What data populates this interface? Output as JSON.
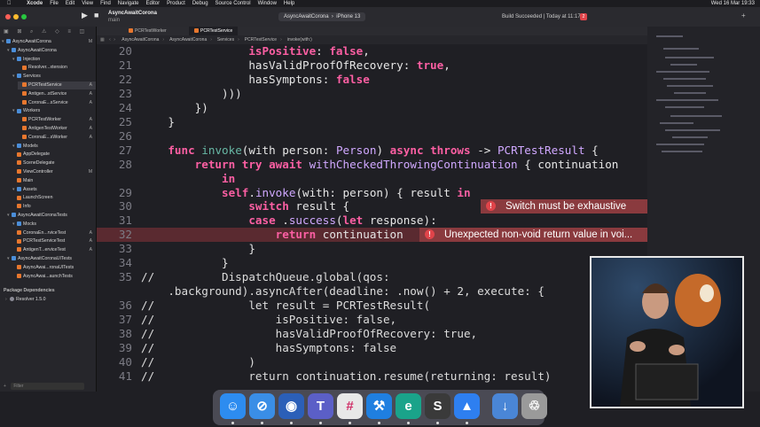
{
  "menubar": {
    "app": "Xcode",
    "items": [
      "File",
      "Edit",
      "View",
      "Find",
      "Navigate",
      "Editor",
      "Product",
      "Debug",
      "Source Control",
      "Window",
      "Help"
    ],
    "clock": "Wed 16 Mar 19:33"
  },
  "toolbar": {
    "project": "AsyncAwaitCorona",
    "branch": "main",
    "scheme": "AsyncAwaitCorona",
    "device": "iPhone 13",
    "status": "Build Succeeded | Today at 11:17",
    "error_count": "2"
  },
  "tabs": [
    "PCRTestWorker",
    "PCRTestService"
  ],
  "jumpbar": [
    "AsyncAwaitCorona",
    "AsyncAwaitCorona",
    "Services",
    "PCRTestService",
    "invoke(with:)"
  ],
  "navigator": {
    "items": [
      {
        "label": "AsyncAwaitCorona",
        "indent": 0,
        "kind": "project",
        "badge": "M"
      },
      {
        "label": "AsyncAwaitCorona",
        "indent": 1,
        "kind": "folder",
        "badge": ""
      },
      {
        "label": "Injection",
        "indent": 2,
        "kind": "folder",
        "badge": ""
      },
      {
        "label": "Resolver...xtension",
        "indent": 3,
        "kind": "swift",
        "badge": ""
      },
      {
        "label": "Services",
        "indent": 2,
        "kind": "folder",
        "badge": ""
      },
      {
        "label": "PCRTestService",
        "indent": 3,
        "kind": "swift",
        "badge": "A"
      },
      {
        "label": "Antigen...stService",
        "indent": 3,
        "kind": "swift",
        "badge": "A"
      },
      {
        "label": "CoronaE...sService",
        "indent": 3,
        "kind": "swift",
        "badge": "A"
      },
      {
        "label": "Workers",
        "indent": 2,
        "kind": "folder",
        "badge": ""
      },
      {
        "label": "PCRTestWorker",
        "indent": 3,
        "kind": "swift",
        "badge": "A"
      },
      {
        "label": "AntigenTestWorker",
        "indent": 3,
        "kind": "swift",
        "badge": "A"
      },
      {
        "label": "CoronaE...sWorker",
        "indent": 3,
        "kind": "swift",
        "badge": "A"
      },
      {
        "label": "Models",
        "indent": 2,
        "kind": "folder",
        "badge": ""
      },
      {
        "label": "AppDelegate",
        "indent": 2,
        "kind": "swift",
        "badge": ""
      },
      {
        "label": "SceneDelegate",
        "indent": 2,
        "kind": "swift",
        "badge": ""
      },
      {
        "label": "ViewController",
        "indent": 2,
        "kind": "swift",
        "badge": "M"
      },
      {
        "label": "Main",
        "indent": 2,
        "kind": "swift",
        "badge": ""
      },
      {
        "label": "Assets",
        "indent": 2,
        "kind": "folder",
        "badge": ""
      },
      {
        "label": "LaunchScreen",
        "indent": 2,
        "kind": "swift",
        "badge": ""
      },
      {
        "label": "Info",
        "indent": 2,
        "kind": "swift",
        "badge": ""
      },
      {
        "label": "AsyncAwaitCoronaTests",
        "indent": 1,
        "kind": "folder",
        "badge": ""
      },
      {
        "label": "Mocks",
        "indent": 2,
        "kind": "folder",
        "badge": ""
      },
      {
        "label": "CoronaEn...rviceTest",
        "indent": 2,
        "kind": "swift",
        "badge": "A"
      },
      {
        "label": "PCRTestServiceTest",
        "indent": 2,
        "kind": "swift",
        "badge": "A"
      },
      {
        "label": "AntigenT...erviceTest",
        "indent": 2,
        "kind": "swift",
        "badge": "A"
      },
      {
        "label": "AsyncAwaitCoronaUITests",
        "indent": 1,
        "kind": "folder",
        "badge": ""
      },
      {
        "label": "AsyncAwai...ronaUITests",
        "indent": 2,
        "kind": "swift",
        "badge": ""
      },
      {
        "label": "AsyncAwai...aunchTests",
        "indent": 2,
        "kind": "swift",
        "badge": ""
      }
    ],
    "package_header": "Package Dependencies",
    "package": "Resolver 1.5.0",
    "filter_placeholder": "Filter"
  },
  "code": [
    {
      "n": "20",
      "html": "                <span class='kw'>isPositive</span>: <span class='kw'>false</span>,"
    },
    {
      "n": "21",
      "html": "                hasValidProofOfRecovery: <span class='kw'>true</span>,"
    },
    {
      "n": "22",
      "html": "                hasSymptons: <span class='kw'>false</span>"
    },
    {
      "n": "23",
      "html": "            )))"
    },
    {
      "n": "24",
      "html": "        })"
    },
    {
      "n": "25",
      "html": "    }"
    },
    {
      "n": "26",
      "html": ""
    },
    {
      "n": "27",
      "html": "    <span class='kw'>func</span> <span class='fn'>invoke</span>(with person: <span class='ty'>Person</span>) <span class='kw'>async throws</span> -&gt; <span class='ty'>PCRTestResult</span> {"
    },
    {
      "n": "28",
      "html": "        <span class='kw'>return try await</span> <span class='ty'>withCheckedThrowingContinuation</span> { continuation"
    },
    {
      "n": "",
      "html": "            <span class='kw'>in</span>"
    },
    {
      "n": "29",
      "html": "            <span class='kw'>self</span>.<span class='ty'>invoke</span>(with: person) { result <span class='kw'>in</span>"
    },
    {
      "n": "30",
      "html": "                <span class='kw'>switch</span> result {"
    },
    {
      "n": "31",
      "html": "                <span class='kw'>case</span> .<span class='ty'>success</span>(<span class='kw'>let</span> response):"
    },
    {
      "n": "32",
      "html": "                    <span class='kw'>return</span> continuation"
    },
    {
      "n": "33",
      "html": "                }"
    },
    {
      "n": "34",
      "html": "            }"
    },
    {
      "n": "35",
      "html": "<span class='cm'>//          DispatchQueue.global(qos:</span>"
    },
    {
      "n": "",
      "html": "<span class='cm'>    .background).asyncAfter(deadline: .now() + 2, execute: {</span>"
    },
    {
      "n": "36",
      "html": "<span class='cm'>//              let result = PCRTestResult(</span>"
    },
    {
      "n": "37",
      "html": "<span class='cm'>//                  isPositive: false,</span>"
    },
    {
      "n": "38",
      "html": "<span class='cm'>//                  hasValidProofOfRecovery: true,</span>"
    },
    {
      "n": "39",
      "html": "<span class='cm'>//                  hasSymptons: false</span>"
    },
    {
      "n": "40",
      "html": "<span class='cm'>//              )</span>"
    },
    {
      "n": "41",
      "html": "<span class='cm'>//              return continuation.resume(returning: result)</span>"
    }
  ],
  "errors": [
    {
      "message": "Switch must be exhaustive"
    },
    {
      "message": "Unexpected non-void return value in voi..."
    }
  ],
  "dock": [
    {
      "name": "finder",
      "glyph": "☺",
      "color": "#2d8cf0"
    },
    {
      "name": "safari",
      "glyph": "⊘",
      "color": "#3a8ee6"
    },
    {
      "name": "maps",
      "glyph": "◉",
      "color": "#2b5fb8"
    },
    {
      "name": "teams",
      "glyph": "T",
      "color": "#5b5fc7"
    },
    {
      "name": "slack",
      "glyph": "#",
      "color": "#e8e8e8"
    },
    {
      "name": "xcode",
      "glyph": "⚒",
      "color": "#1f7fe0"
    },
    {
      "name": "edge",
      "glyph": "e",
      "color": "#1aa38a"
    },
    {
      "name": "sublime",
      "glyph": "S",
      "color": "#3a3a3a"
    },
    {
      "name": "keynote",
      "glyph": "▲",
      "color": "#2e7ff0"
    },
    {
      "name": "downloads",
      "glyph": "↓",
      "color": "#4a86d6"
    },
    {
      "name": "trash",
      "glyph": "♲",
      "color": "#9a9a9a"
    }
  ]
}
